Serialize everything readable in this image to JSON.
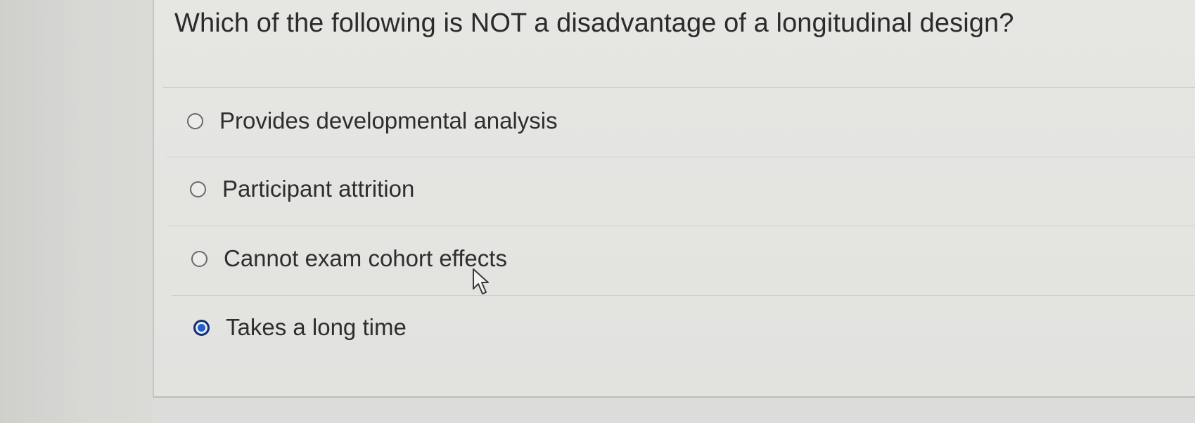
{
  "question": {
    "text": "Which of the following is NOT a disadvantage of a longitudinal design?"
  },
  "options": [
    {
      "label": "Provides developmental analysis",
      "selected": false
    },
    {
      "label": "Participant attrition",
      "selected": false
    },
    {
      "label": "Cannot exam cohort effects",
      "selected": false
    },
    {
      "label": "Takes a long time",
      "selected": true
    }
  ],
  "colors": {
    "selected_radio": "#1f5fd0",
    "selected_radio_ring": "#12306e"
  },
  "icons": {
    "pointer": "mouse-pointer-icon"
  }
}
